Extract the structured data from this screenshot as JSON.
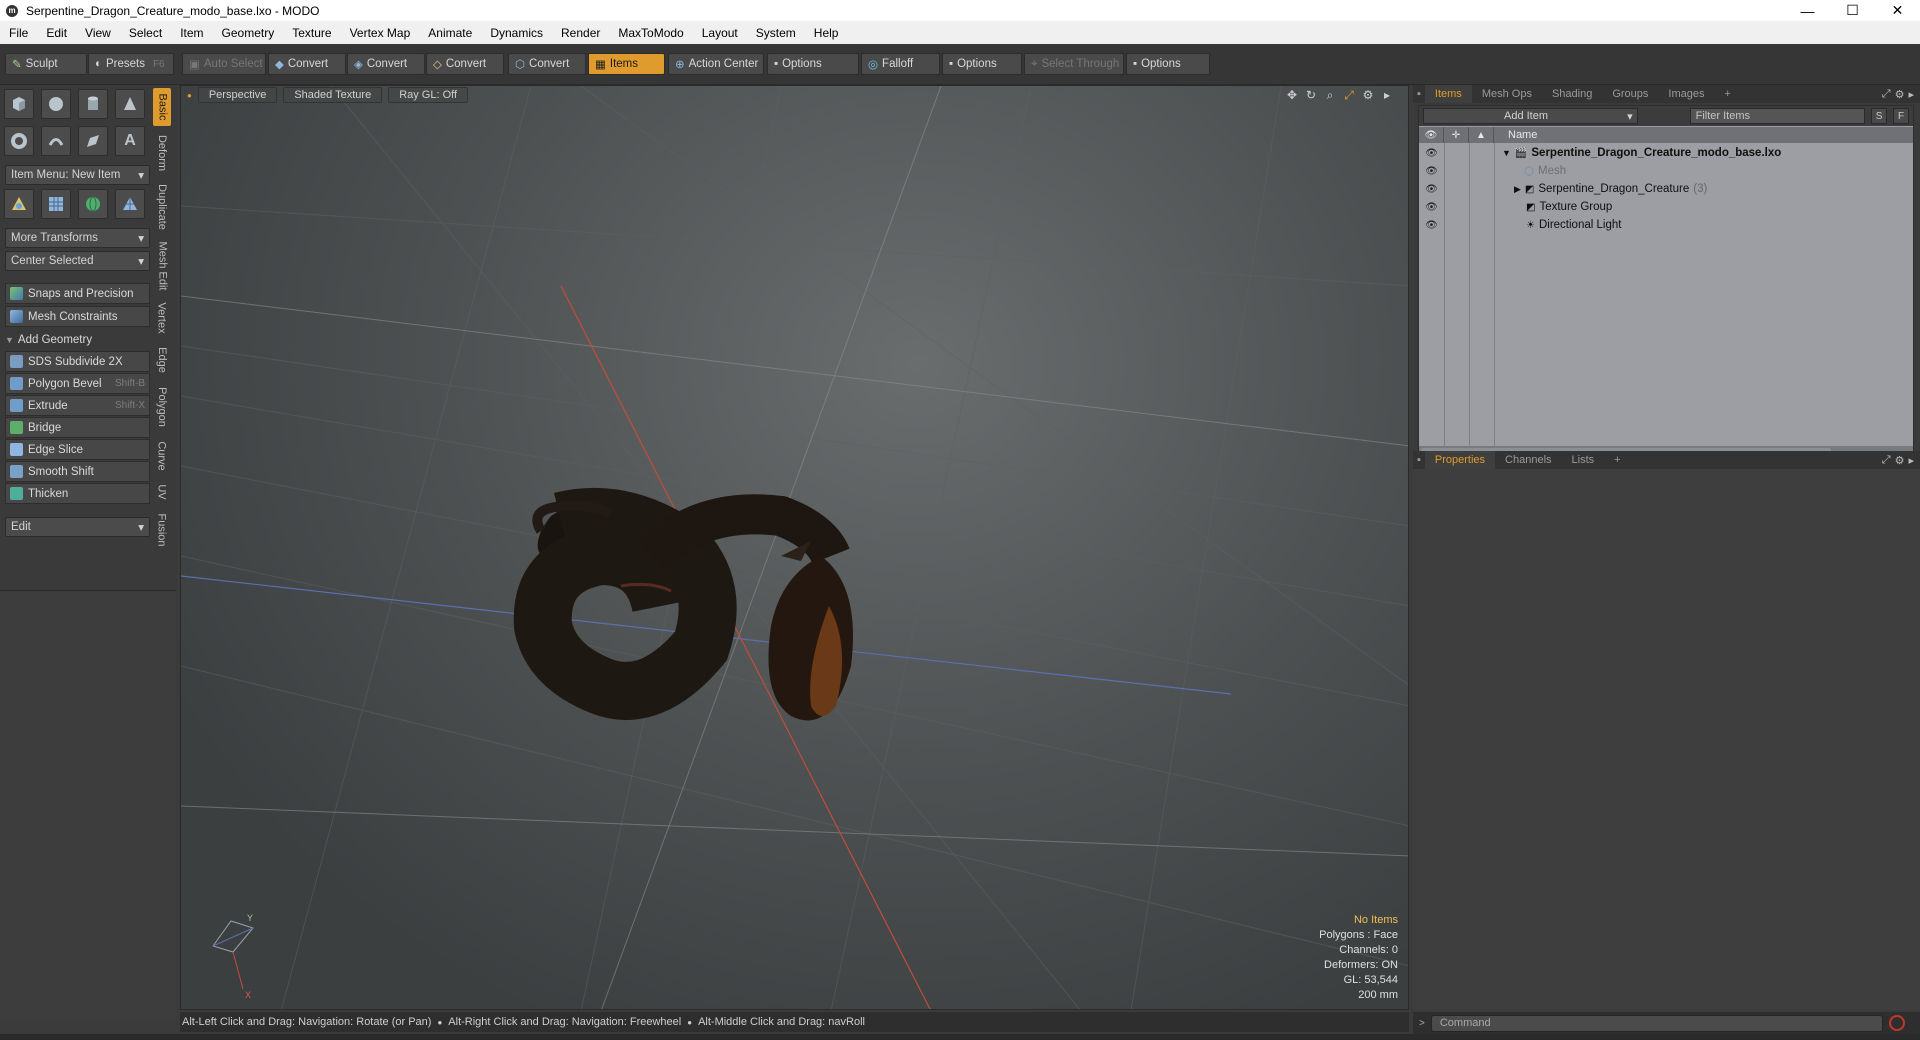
{
  "window": {
    "title": "Serpentine_Dragon_Creature_modo_base.lxo - MODO",
    "minimize": "—",
    "maximize": "☐",
    "close": "✕"
  },
  "menu": [
    "File",
    "Edit",
    "View",
    "Select",
    "Item",
    "Geometry",
    "Texture",
    "Vertex Map",
    "Animate",
    "Dynamics",
    "Render",
    "MaxToModo",
    "Layout",
    "System",
    "Help"
  ],
  "toolbar": {
    "sculpt": "Sculpt",
    "presets": "Presets",
    "presets_shortcut": "F6",
    "auto_select": "Auto Select",
    "convert1": "Convert",
    "convert2": "Convert",
    "convert3": "Convert",
    "convert4": "Convert",
    "items": "Items",
    "action_center": "Action Center",
    "options1": "Options",
    "falloff": "Falloff",
    "options2": "Options",
    "select_through": "Select Through",
    "options3": "Options"
  },
  "left": {
    "item_menu": "Item Menu: New Item",
    "more_transforms": "More Transforms",
    "center_selected": "Center Selected",
    "snaps": "Snaps and Precision",
    "mesh_constraints": "Mesh Constraints",
    "add_geometry": "Add Geometry",
    "tools": [
      {
        "label": "SDS Subdivide 2X",
        "shortcut": ""
      },
      {
        "label": "Polygon Bevel",
        "shortcut": "Shift-B"
      },
      {
        "label": "Extrude",
        "shortcut": "Shift-X"
      },
      {
        "label": "Bridge",
        "shortcut": ""
      },
      {
        "label": "Edge Slice",
        "shortcut": ""
      },
      {
        "label": "Smooth Shift",
        "shortcut": ""
      },
      {
        "label": "Thicken",
        "shortcut": ""
      }
    ],
    "edit_dropdown": "Edit",
    "side_tabs": [
      "Basic",
      "Deform",
      "Duplicate",
      "Mesh Edit",
      "Vertex",
      "Edge",
      "Polygon",
      "Curve",
      "UV",
      "Fusion"
    ]
  },
  "viewport": {
    "perspective": "Perspective",
    "shading": "Shaded Texture",
    "raygl": "Ray GL: Off",
    "info": {
      "no_items": "No Items",
      "polygons": "Polygons : Face",
      "channels": "Channels: 0",
      "deformers": "Deformers: ON",
      "gl": "GL: 53,544",
      "scale": "200 mm"
    }
  },
  "items_panel": {
    "tabs": [
      "Items",
      "Mesh Ops",
      "Shading",
      "Groups",
      "Images"
    ],
    "add_item": "Add Item",
    "filter_placeholder": "Filter Items",
    "s_btn": "S",
    "f_btn": "F",
    "name_header": "Name",
    "rows": [
      {
        "name": "Serpentine_Dragon_Creature_modo_base.lxo",
        "count": ""
      },
      {
        "name": "Mesh",
        "count": ""
      },
      {
        "name": "Serpentine_Dragon_Creature",
        "count": "(3)"
      },
      {
        "name": "Texture Group",
        "count": ""
      },
      {
        "name": "Directional Light",
        "count": ""
      }
    ]
  },
  "properties_panel": {
    "tabs": [
      "Properties",
      "Channels",
      "Lists"
    ]
  },
  "status": {
    "hint1": "Alt-Left Click and Drag: Navigation: Rotate (or Pan)",
    "hint2": "Alt-Right Click and Drag: Navigation: Freewheel",
    "hint3": "Alt-Middle Click and Drag: navRoll",
    "command_placeholder": "Command"
  },
  "colors": {
    "accent": "#e09b2e",
    "panel": "#3a3a3a",
    "tree_bg": "#9c9ea3"
  }
}
